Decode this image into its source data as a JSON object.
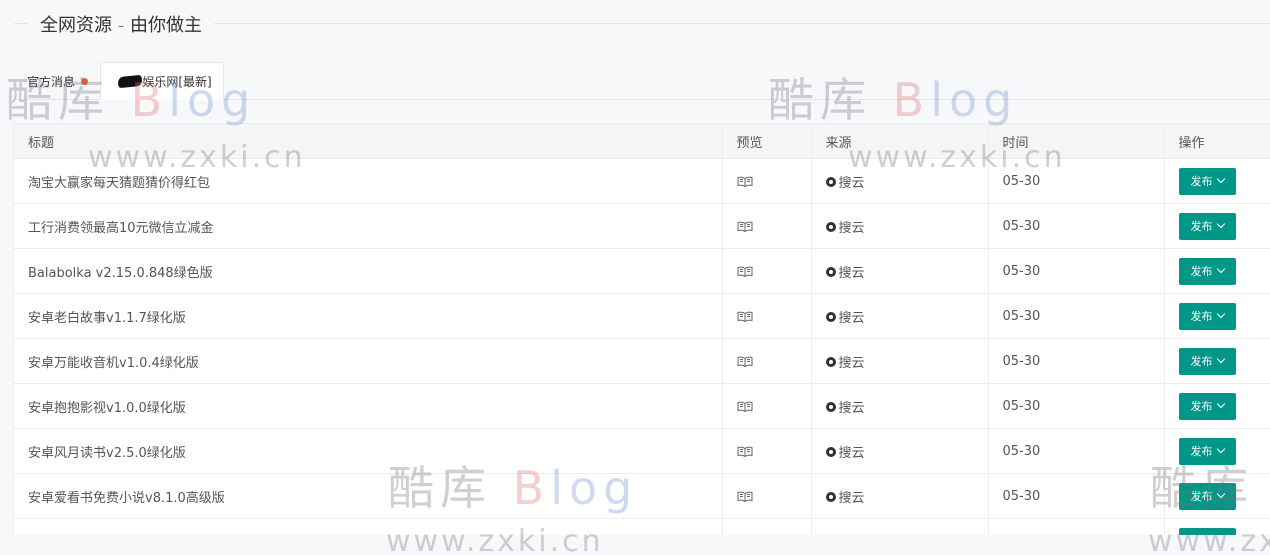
{
  "header": {
    "title": "全网资源 - 由你做主"
  },
  "tabs": [
    {
      "label": "官方消息",
      "has_dot": true
    },
    {
      "label": "娱乐网[最新]",
      "active": true
    }
  ],
  "table": {
    "columns": [
      "标题",
      "预览",
      "来源",
      "时间",
      "操作"
    ],
    "rows": [
      {
        "title": "淘宝大赢家每天猜题猜价得红包",
        "source": "搜云",
        "time": "05-30",
        "action": "发布"
      },
      {
        "title": "工行消费领最高10元微信立减金",
        "source": "搜云",
        "time": "05-30",
        "action": "发布"
      },
      {
        "title": "Balabolka v2.15.0.848绿色版",
        "source": "搜云",
        "time": "05-30",
        "action": "发布"
      },
      {
        "title": "安卓老白故事v1.1.7绿化版",
        "source": "搜云",
        "time": "05-30",
        "action": "发布"
      },
      {
        "title": "安卓万能收音机v1.0.4绿化版",
        "source": "搜云",
        "time": "05-30",
        "action": "发布"
      },
      {
        "title": "安卓抱抱影视v1.0.0绿化版",
        "source": "搜云",
        "time": "05-30",
        "action": "发布"
      },
      {
        "title": "安卓风月读书v2.5.0绿化版",
        "source": "搜云",
        "time": "05-30",
        "action": "发布"
      },
      {
        "title": "安卓爱看书免费小说v8.1.0高级版",
        "source": "搜云",
        "time": "05-30",
        "action": "发布"
      },
      {
        "title": "",
        "source": "",
        "time": "",
        "action": "发布"
      }
    ]
  },
  "watermark": {
    "logo_cn": "酷库",
    "logo_en_b": "B",
    "logo_en_rest": "log",
    "url": "www.zxki.cn"
  },
  "colors": {
    "accent": "#009688",
    "dot": "#ff5722"
  }
}
